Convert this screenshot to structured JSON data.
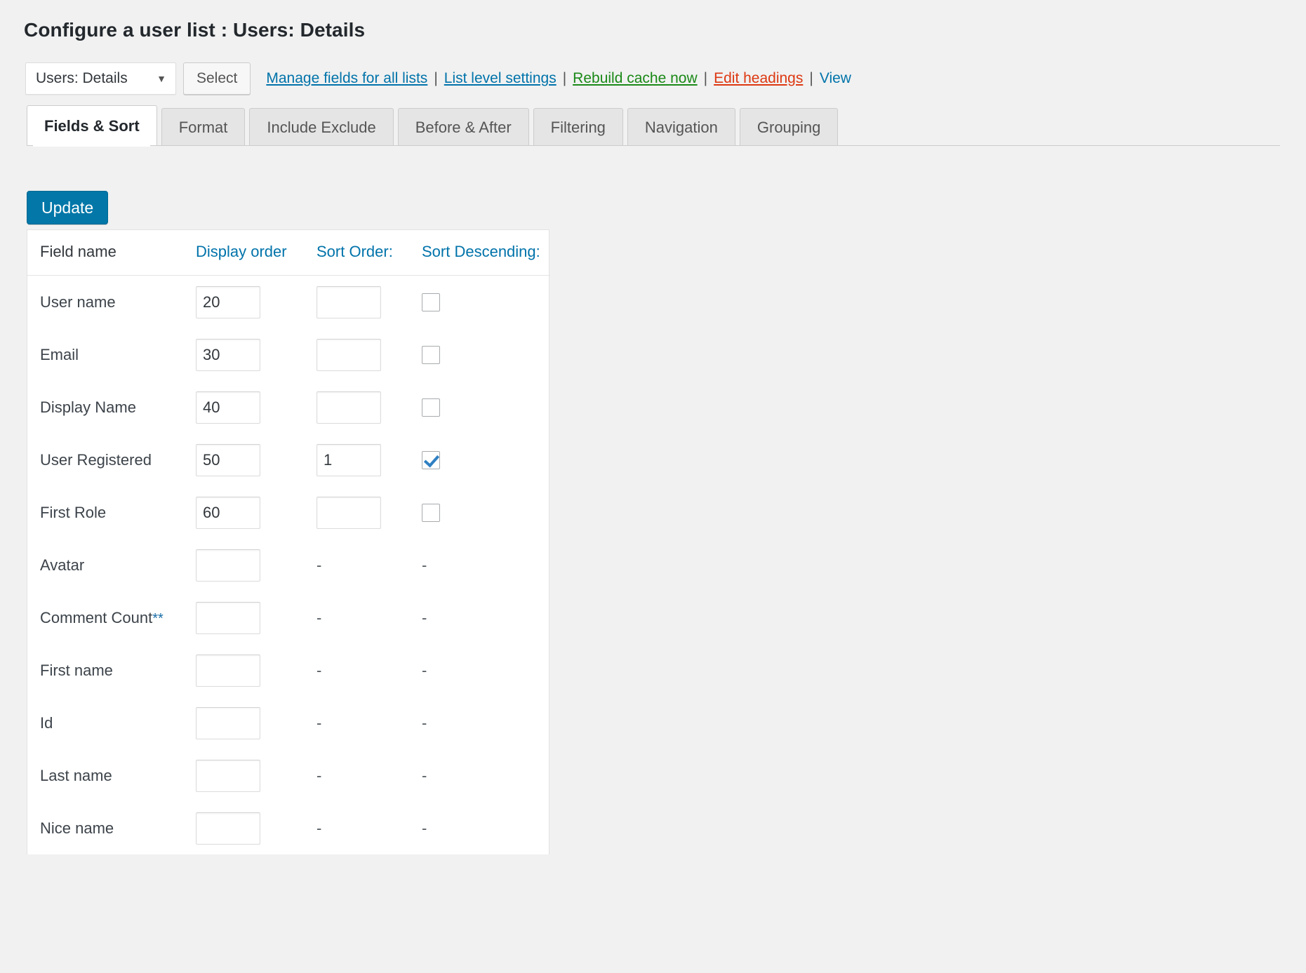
{
  "page_title": "Configure a user list : Users: Details",
  "toolbar": {
    "list_select_value": "Users: Details",
    "list_select_caret": "▼",
    "select_button_label": "Select",
    "links": [
      {
        "label": "Manage fields for all lists",
        "style": "blue"
      },
      {
        "label": "List level settings",
        "style": "blue"
      },
      {
        "label": "Rebuild cache now",
        "style": "green"
      },
      {
        "label": "Edit headings",
        "style": "red"
      },
      {
        "label": "View",
        "style": "plain"
      }
    ],
    "separator": "|"
  },
  "tabs": [
    {
      "label": "Fields & Sort",
      "active": true
    },
    {
      "label": "Format",
      "active": false
    },
    {
      "label": "Include Exclude",
      "active": false
    },
    {
      "label": "Before & After",
      "active": false
    },
    {
      "label": "Filtering",
      "active": false
    },
    {
      "label": "Navigation",
      "active": false
    },
    {
      "label": "Grouping",
      "active": false
    }
  ],
  "update_button_label": "Update",
  "fields_table": {
    "headers": {
      "field_name": "Field name",
      "display_order": "Display order",
      "sort_order": "Sort Order:",
      "sort_descending": "Sort Descending:"
    },
    "dash": "-",
    "rows": [
      {
        "name": "User name",
        "stars": "",
        "display_order": "20",
        "sortable": true,
        "sort_order": "",
        "sort_descending": false
      },
      {
        "name": "Email",
        "stars": "",
        "display_order": "30",
        "sortable": true,
        "sort_order": "",
        "sort_descending": false
      },
      {
        "name": "Display Name",
        "stars": "",
        "display_order": "40",
        "sortable": true,
        "sort_order": "",
        "sort_descending": false
      },
      {
        "name": "User Registered",
        "stars": "",
        "display_order": "50",
        "sortable": true,
        "sort_order": "1",
        "sort_descending": true
      },
      {
        "name": "First Role",
        "stars": "",
        "display_order": "60",
        "sortable": true,
        "sort_order": "",
        "sort_descending": false
      },
      {
        "name": "Avatar",
        "stars": "",
        "display_order": "",
        "sortable": false,
        "sort_order": "",
        "sort_descending": false
      },
      {
        "name": "Comment Count",
        "stars": "**",
        "display_order": "",
        "sortable": false,
        "sort_order": "",
        "sort_descending": false
      },
      {
        "name": "First name",
        "stars": "",
        "display_order": "",
        "sortable": false,
        "sort_order": "",
        "sort_descending": false
      },
      {
        "name": "Id",
        "stars": "",
        "display_order": "",
        "sortable": false,
        "sort_order": "",
        "sort_descending": false
      },
      {
        "name": "Last name",
        "stars": "",
        "display_order": "",
        "sortable": false,
        "sort_order": "",
        "sort_descending": false
      },
      {
        "name": "Nice name",
        "stars": "",
        "display_order": "",
        "sortable": false,
        "sort_order": "",
        "sort_descending": false
      }
    ]
  },
  "colors": {
    "accent_blue": "#0073aa",
    "link_green": "#1a8917",
    "link_red": "#dd3811",
    "button_blue": "#0277a8",
    "page_bg": "#f1f1f1"
  }
}
